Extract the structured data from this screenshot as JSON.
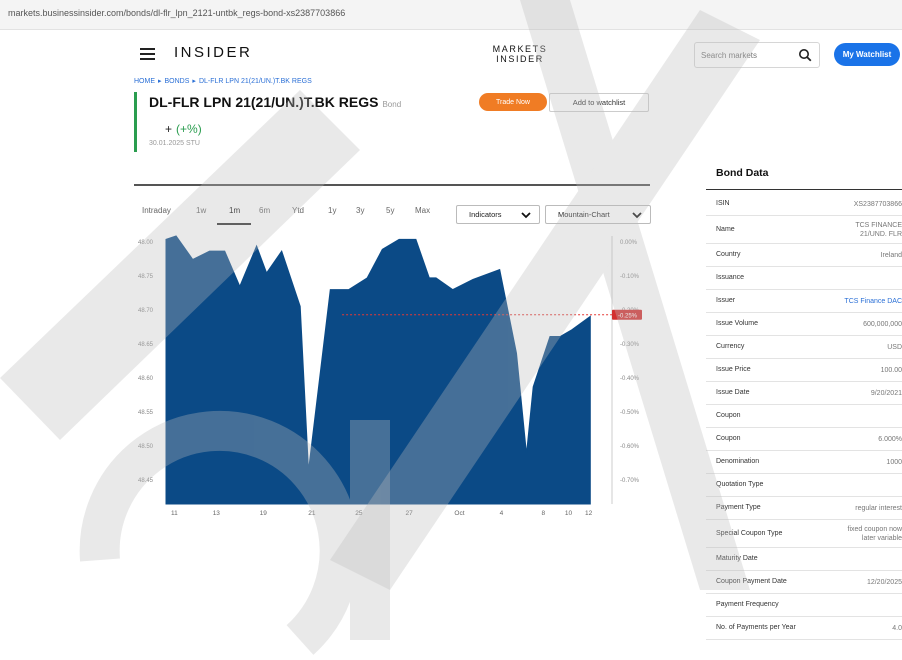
{
  "browser": {
    "url": "markets.businessinsider.com/bonds/dl-flr_lpn_2121-untbk_regs-bond-xs2387703866"
  },
  "header": {
    "logo": "INSIDER",
    "markets_logo_line1": "MARKETS",
    "markets_logo_line2": "INSIDER",
    "search_placeholder": "Search markets",
    "watchlist_label": "My Watchlist"
  },
  "breadcrumb": [
    "HOME",
    "BONDS",
    "DL-FLR LPN 21(21/UN.)T.BK REGS"
  ],
  "bond": {
    "title": "DL-FLR LPN 21(21/UN.)T.BK REGS",
    "type": "Bond",
    "change_sign": "+",
    "change": "(+%)",
    "date": "30.01.2025  STU",
    "trade_label": "Trade Now",
    "add_watchlist_label": "Add to watchlist"
  },
  "chart_controls": {
    "tabs": [
      "Intraday",
      "1w",
      "1m",
      "6m",
      "Ytd",
      "1y",
      "3y",
      "5y",
      "Max"
    ],
    "active_tab": "1m",
    "indicators_label": "Indicators",
    "chart_type_label": "Mountain-Chart"
  },
  "chart_data": {
    "type": "area",
    "color": "#0b4a86",
    "x": [
      0,
      0.6,
      1.6,
      2.6,
      3.5,
      4.4,
      5.4,
      6.0,
      6.9,
      8.0,
      8.5,
      9.8,
      10.9,
      12.0,
      12.9,
      13.9,
      14.9,
      15.7,
      16.1,
      17.1,
      18.3,
      19.9,
      20.9,
      21.5,
      21.9,
      22.9,
      23.5,
      24.2,
      25.3
    ],
    "y": [
      47.9,
      48.0,
      47.3,
      47.55,
      47.55,
      46.5,
      47.7,
      46.9,
      47.55,
      45.9,
      41.0,
      46.4,
      46.4,
      46.75,
      47.6,
      47.9,
      47.9,
      46.75,
      46.75,
      46.4,
      46.7,
      47.0,
      44.5,
      41.5,
      43.5,
      45.0,
      45.0,
      45.2,
      45.6
    ],
    "xlim": [
      0,
      26
    ],
    "ylim": [
      40.0,
      48.0
    ],
    "y_ticks": [
      "48.00",
      "48.75",
      "48.70",
      "48.65",
      "48.60",
      "48.55",
      "48.50",
      "48.45"
    ],
    "right_ticks": [
      "0.00%",
      "-0.10%",
      "-0.20%",
      "-0.30%",
      "-0.40%",
      "-0.50%",
      "-0.60%",
      "-0.70%"
    ],
    "x_ticks": [
      {
        "label": "11",
        "x": 0.5
      },
      {
        "label": "13",
        "x": 3.0
      },
      {
        "label": "19",
        "x": 5.8
      },
      {
        "label": "21",
        "x": 8.7
      },
      {
        "label": "25",
        "x": 11.5
      },
      {
        "label": "27",
        "x": 14.5
      },
      {
        "label": "Oct",
        "x": 17.5
      },
      {
        "label": "4",
        "x": 20.0
      },
      {
        "label": "8",
        "x": 22.5
      },
      {
        "label": "10",
        "x": 24.0
      },
      {
        "label": "12",
        "x": 25.2
      }
    ],
    "reference_value": 45.65,
    "reference_label": "-0.25%"
  },
  "bond_data": {
    "title": "Bond Data",
    "rows": [
      {
        "label": "ISIN",
        "value": "XS2387703866"
      },
      {
        "label": "Name",
        "value": "TCS FINANCE\n21/UND. FLR"
      },
      {
        "label": "Country",
        "value": "Ireland"
      },
      {
        "label": "Issuance",
        "value": ""
      },
      {
        "label": "Issuer",
        "value": "TCS Finance DAC",
        "link": true
      },
      {
        "label": "Issue Volume",
        "value": "600,000,000"
      },
      {
        "label": "Currency",
        "value": "USD"
      },
      {
        "label": "Issue Price",
        "value": "100.00"
      },
      {
        "label": "Issue Date",
        "value": "9/20/2021"
      },
      {
        "label": "Coupon",
        "value": ""
      },
      {
        "label": "Coupon",
        "value": "6.000%"
      },
      {
        "label": "Denomination",
        "value": "1000"
      },
      {
        "label": "Quotation Type",
        "value": ""
      },
      {
        "label": "Payment Type",
        "value": "regular interest"
      },
      {
        "label": "Special Coupon Type",
        "value": "fixed coupon now\nlater variable"
      },
      {
        "label": "Maturity Date",
        "value": ""
      },
      {
        "label": "Coupon Payment Date",
        "value": "12/20/2025"
      },
      {
        "label": "Payment Frequency",
        "value": ""
      },
      {
        "label": "No. of Payments per Year",
        "value": "4.0"
      }
    ]
  }
}
